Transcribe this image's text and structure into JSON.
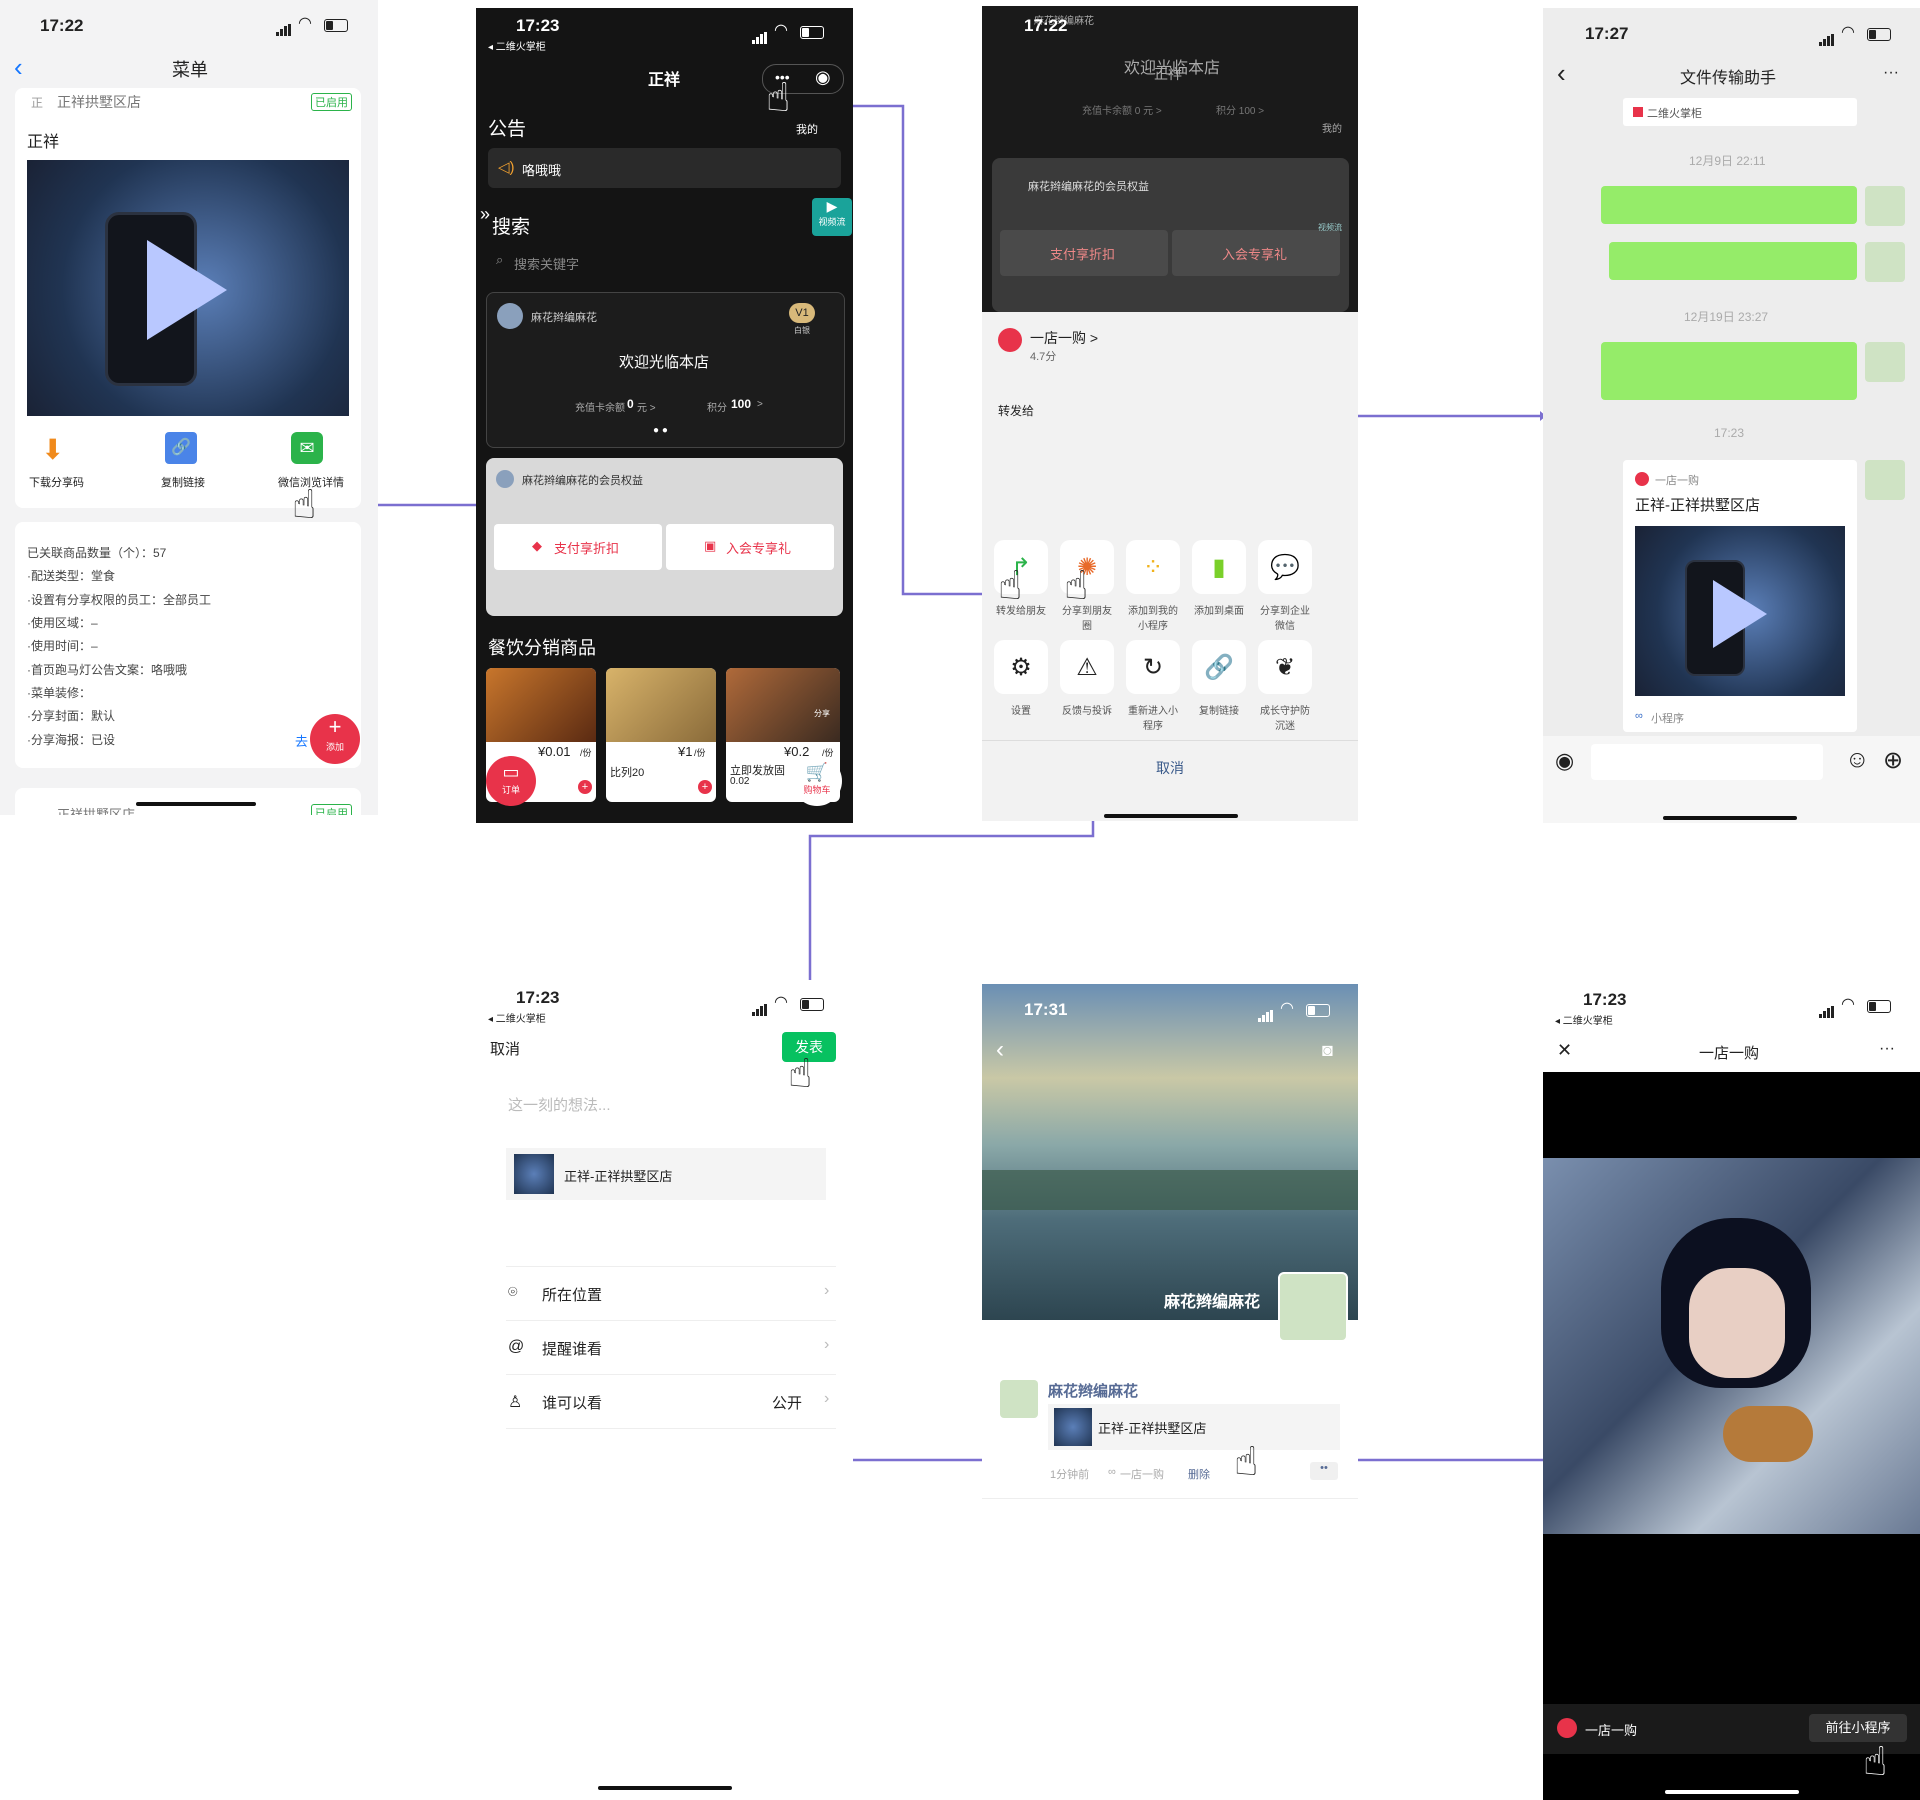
{
  "colors": {
    "flow_line": "#7b6fd0",
    "wechat_green": "#95ec69",
    "publish_green": "#07c160",
    "red": "#e8334a",
    "dark_bg": "#111111",
    "gold": "#d8b97a"
  },
  "s1": {
    "time": "17:22",
    "title": "菜单",
    "store_name": "正祥拱墅区店",
    "enabled_badge": "已启用",
    "item_name": "正祥",
    "actions": [
      "下载分享码",
      "复制链接",
      "微信浏览详情"
    ],
    "details": [
      "已关联商品数量（个）：57",
      "·配送类型：堂食",
      "·设置有分享权限的员工：全部员工",
      "·使用区域：–",
      "·使用时间：–",
      "·首页跑马灯公告文案：咯哦哦",
      "·菜单装修：",
      "·分享封面：默认",
      "·分享海报：已设"
    ],
    "go_link": "去",
    "add_label": "添加",
    "next_store_name": "正祥拱墅区店",
    "next_badge": "已启用"
  },
  "s2": {
    "time": "17:23",
    "back_app": "◂ 二维火掌柜",
    "title": "正祥",
    "my_label": "我的",
    "notice_heading": "公告",
    "notice_text": "咯哦哦",
    "search_heading": "搜索",
    "search_placeholder": "搜索关键字",
    "video_label": "视频流",
    "member_name": "麻花辫编麻花",
    "level_badge": "V1",
    "level_sub": "白银",
    "welcome": "欢迎光临本店",
    "balance_label": "充值卡余额",
    "balance_value": "0",
    "balance_unit": "元 >",
    "points_label": "积分",
    "points_value": "100",
    "points_suffix": ">",
    "rights_title": "麻花辫编麻花的会员权益",
    "btn_discount": "支付享折扣",
    "btn_gift": "入会专享礼",
    "goods_heading": "餐饮分销商品",
    "goods": [
      {
        "price": "¥0.01",
        "unit": "/份",
        "name": ""
      },
      {
        "price": "¥1",
        "unit": "/份",
        "name": "比列20"
      },
      {
        "price": "¥0.2",
        "unit": "/份",
        "name": "立即发放固",
        "sub": "0.02"
      }
    ],
    "order_label": "订单",
    "cart_label": "购物车",
    "share_badge": "分享"
  },
  "s3": {
    "time": "17:22",
    "bg_name": "麻花辫编麻花",
    "bg_welcome": "欢迎光临本店",
    "bg_title": "正祥",
    "bg_balance": "充值卡余额 0 元 >",
    "bg_points": "积分 100 >",
    "bg_my": "我的",
    "bg_rights": "麻花辫编麻花的会员权益",
    "bg_btn_discount": "支付享折扣",
    "bg_btn_gift": "入会专享礼",
    "bg_video": "视频流",
    "app_name": "一店一购 >",
    "rating": "4.7分",
    "forward_to": "转发给",
    "row1": [
      "转发给朋友",
      "分享到朋友圈",
      "添加到我的小程序",
      "添加到桌面",
      "分享到企业微信"
    ],
    "row2": [
      "设置",
      "反馈与投诉",
      "重新进入小程序",
      "复制链接",
      "成长守护防沉迷"
    ],
    "cancel": "取消"
  },
  "s4": {
    "time": "17:27",
    "title": "文件传输助手",
    "file_tag": "二维火掌柜",
    "ts1": "12月9日 22:11",
    "ts2": "12月19日 23:27",
    "ts3": "17:23",
    "mini_app": "一店一购",
    "mini_title": "正祥-正祥拱墅区店",
    "mini_tag": "小程序"
  },
  "s5": {
    "time": "17:23",
    "back_app": "◂ 二维火掌柜",
    "cancel": "取消",
    "publish": "发表",
    "placeholder": "这一刻的想法...",
    "share_title": "正祥-正祥拱墅区店",
    "rows": [
      {
        "icon": "location-icon",
        "label": "所在位置",
        "value": ""
      },
      {
        "icon": "at-icon",
        "label": "提醒谁看",
        "value": ""
      },
      {
        "icon": "person-icon",
        "label": "谁可以看",
        "value": "公开"
      }
    ]
  },
  "s6": {
    "time": "17:31",
    "cover_name": "麻花辫编麻花",
    "poster_name": "麻花辫编麻花",
    "share_title": "正祥-正祥拱墅区店",
    "meta_time": "1分钟前",
    "meta_app": "一店一购",
    "delete": "删除"
  },
  "s7": {
    "time": "17:23",
    "back_app": "◂ 二维火掌柜",
    "title": "一店一购",
    "app_name": "一店一购",
    "go_button": "前往小程序"
  }
}
